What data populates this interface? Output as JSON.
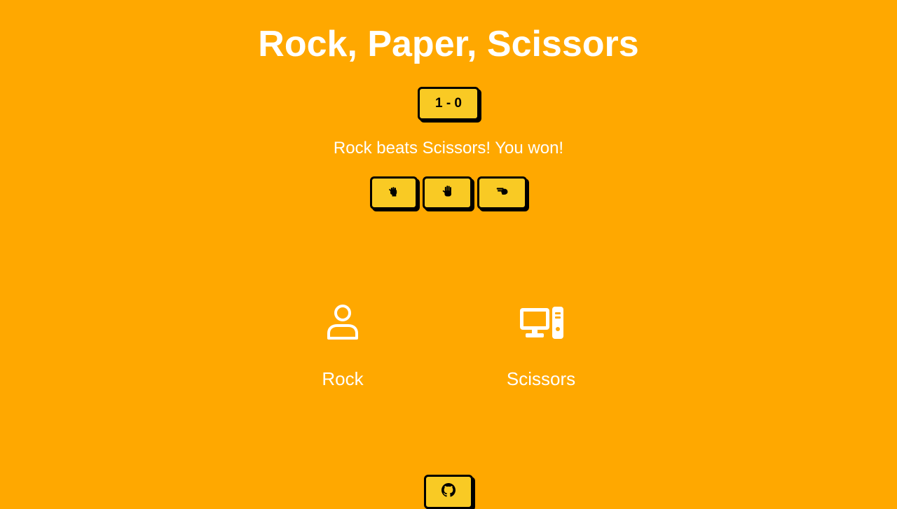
{
  "app": {
    "title": "Rock, Paper, Scissors"
  },
  "score": {
    "label": "1 - 0"
  },
  "result": {
    "message": "Rock beats Scissors! You won!"
  },
  "choices": [
    {
      "name": "Rock",
      "icon": "fist-icon"
    },
    {
      "name": "Paper",
      "icon": "hand-paper-icon"
    },
    {
      "name": "Scissors",
      "icon": "hand-scissors-icon"
    }
  ],
  "player": {
    "icon": "user-icon",
    "pick": "Rock"
  },
  "computer": {
    "icon": "desktop-computer-icon",
    "pick": "Scissors"
  },
  "footer": {
    "github_icon": "github-icon"
  },
  "colors": {
    "background": "#ffa800",
    "button": "#f9ca24",
    "text": "#ffffff"
  }
}
